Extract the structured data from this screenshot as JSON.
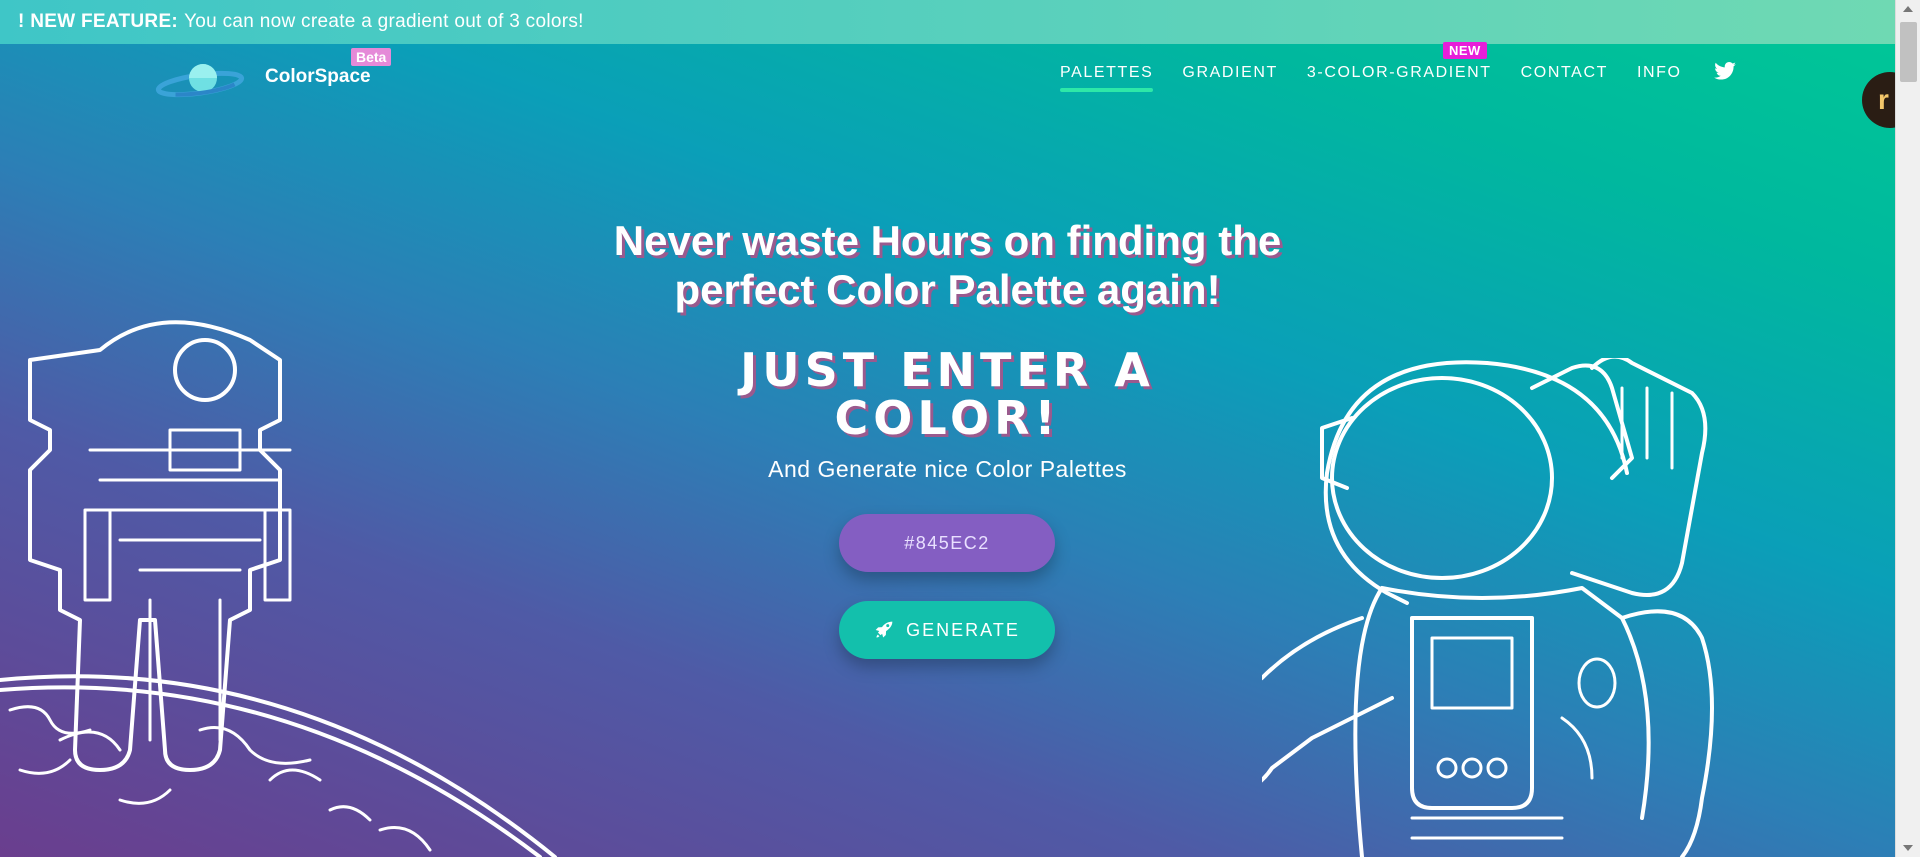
{
  "announcement": {
    "label": "! NEW FEATURE:",
    "text": "You can now create a gradient out of 3 colors!"
  },
  "brand": {
    "name": "ColorSpace",
    "badge": "Beta"
  },
  "nav": {
    "items": [
      {
        "label": "PALETTES",
        "active": true
      },
      {
        "label": "GRADIENT",
        "active": false
      },
      {
        "label": "3-COLOR-GRADIENT",
        "active": false
      },
      {
        "label": "CONTACT",
        "active": false
      },
      {
        "label": "INFO",
        "active": false
      }
    ],
    "new_badge": "NEW",
    "twitter_icon": "twitter-icon"
  },
  "hero": {
    "title_line1": "Never waste Hours on finding the",
    "title_line2": "perfect Color Palette again!",
    "subtitle_line1": "JUST ENTER A",
    "subtitle_line2": "COLOR!",
    "text": "And Generate nice Color Palettes",
    "input_value": "#845EC2",
    "button_label": "GENERATE",
    "button_icon": "rocket-icon"
  },
  "floating_avatar": {
    "letter": "r"
  },
  "colors": {
    "input_bg": "#845EC2",
    "button_bg": "#13C0AC",
    "beta_badge": "#E58AD8",
    "new_badge": "#E71ED9",
    "active_underline": "#2EE8A8"
  }
}
